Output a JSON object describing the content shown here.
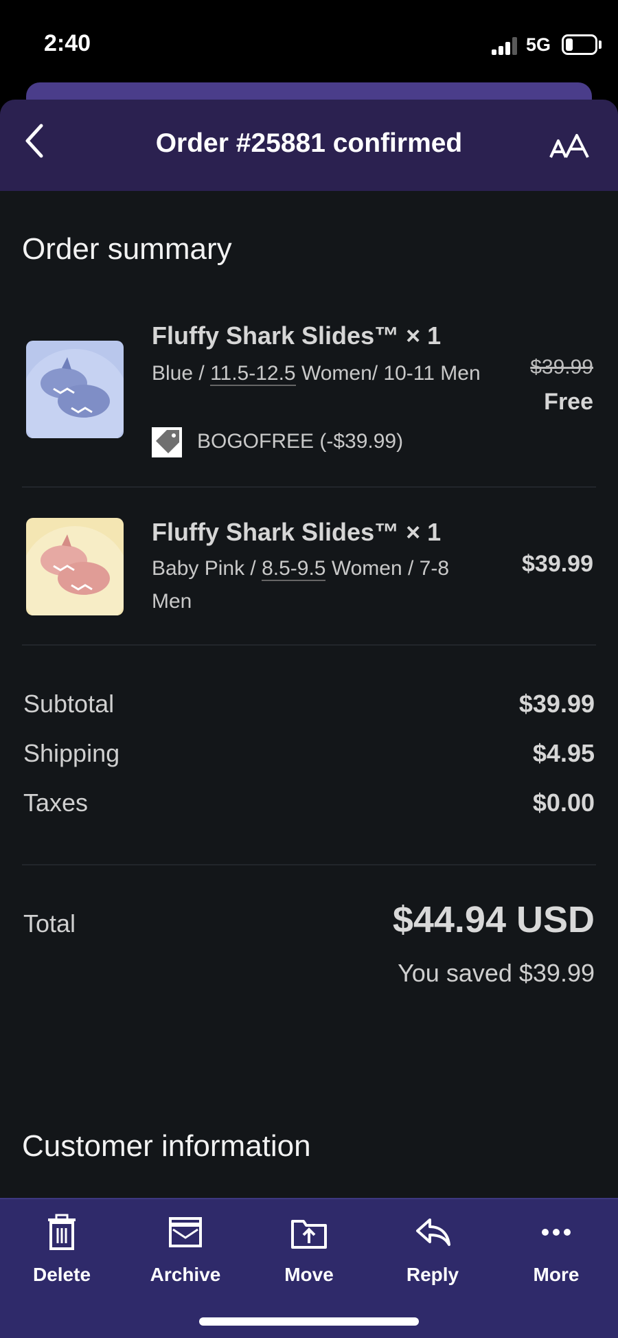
{
  "status_bar": {
    "time": "2:40",
    "network": "5G",
    "battery_level": 0.25
  },
  "header": {
    "title": "Order #25881 confirmed"
  },
  "order_summary": {
    "title": "Order summary",
    "items": [
      {
        "name": "Fluffy Shark Slides™ × 1",
        "variant_prefix": "Blue / ",
        "variant_size": "11.5-12.5",
        "variant_suffix": " Women/ 10-11 Men",
        "original_price": "$39.99",
        "price": "Free",
        "discount": "BOGOFREE (-$39.99)",
        "thumb_color": "#b9c7ec"
      },
      {
        "name": "Fluffy Shark Slides™ × 1",
        "variant_prefix": "Baby Pink / ",
        "variant_size": "8.5-9.5",
        "variant_suffix": " Women / 7-8 Men",
        "price": "$39.99",
        "thumb_color": "#f4e6b3"
      }
    ]
  },
  "totals": {
    "subtotal_label": "Subtotal",
    "subtotal": "$39.99",
    "shipping_label": "Shipping",
    "shipping": "$4.95",
    "taxes_label": "Taxes",
    "taxes": "$0.00",
    "total_label": "Total",
    "total": "$44.94 USD",
    "saved": "You saved $39.99"
  },
  "customer_info": {
    "title": "Customer information"
  },
  "toolbar": {
    "items": [
      {
        "label": "Delete",
        "icon": "trash-icon"
      },
      {
        "label": "Archive",
        "icon": "archive-icon"
      },
      {
        "label": "Move",
        "icon": "move-icon"
      },
      {
        "label": "Reply",
        "icon": "reply-icon"
      },
      {
        "label": "More",
        "icon": "more-dots-icon"
      }
    ]
  },
  "colors": {
    "header_bg": "#2b2150",
    "content_bg": "#131619",
    "toolbar_bg": "#2f2a6a"
  }
}
